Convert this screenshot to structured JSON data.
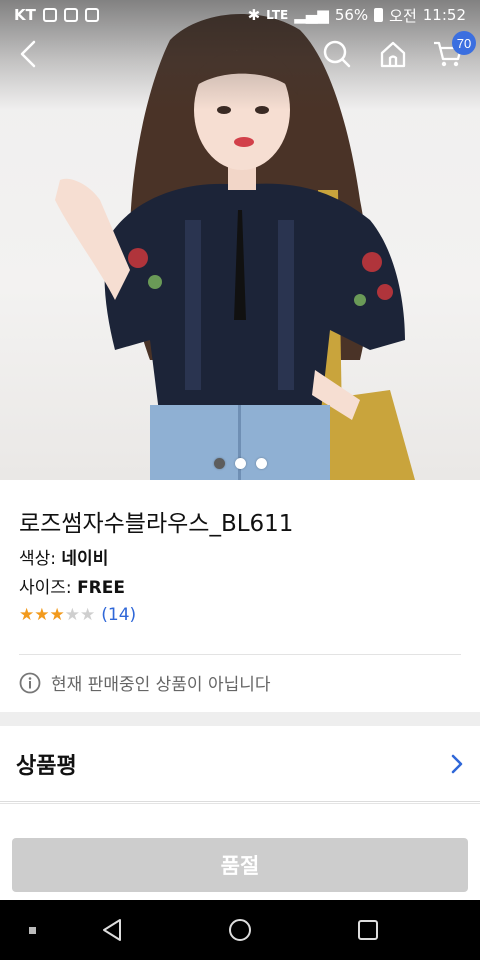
{
  "status_bar": {
    "carrier": "KT",
    "battery": "56%",
    "ampm": "오전",
    "time": "11:52",
    "network": "LTE"
  },
  "header": {
    "cart_count": "70"
  },
  "gallery": {
    "image_count": 3,
    "active_index": 0
  },
  "product": {
    "name": "로즈썸자수블라우스_BL611",
    "color_label": "색상:",
    "color_value": "네이비",
    "size_label": "사이즈:",
    "size_value": "FREE",
    "rating": 3,
    "rating_max": 5,
    "review_count": "(14)",
    "notice": "현재 판매중인 상품이 아닙니다"
  },
  "reviews_section": {
    "label": "상품평"
  },
  "action": {
    "soldout_label": "품절"
  },
  "colors": {
    "accent": "#2f67d8",
    "star_on": "#f29a1c",
    "star_off": "#cfcfcf",
    "blouse": "#1c2438",
    "soldout_bg": "#cdcdcd"
  }
}
